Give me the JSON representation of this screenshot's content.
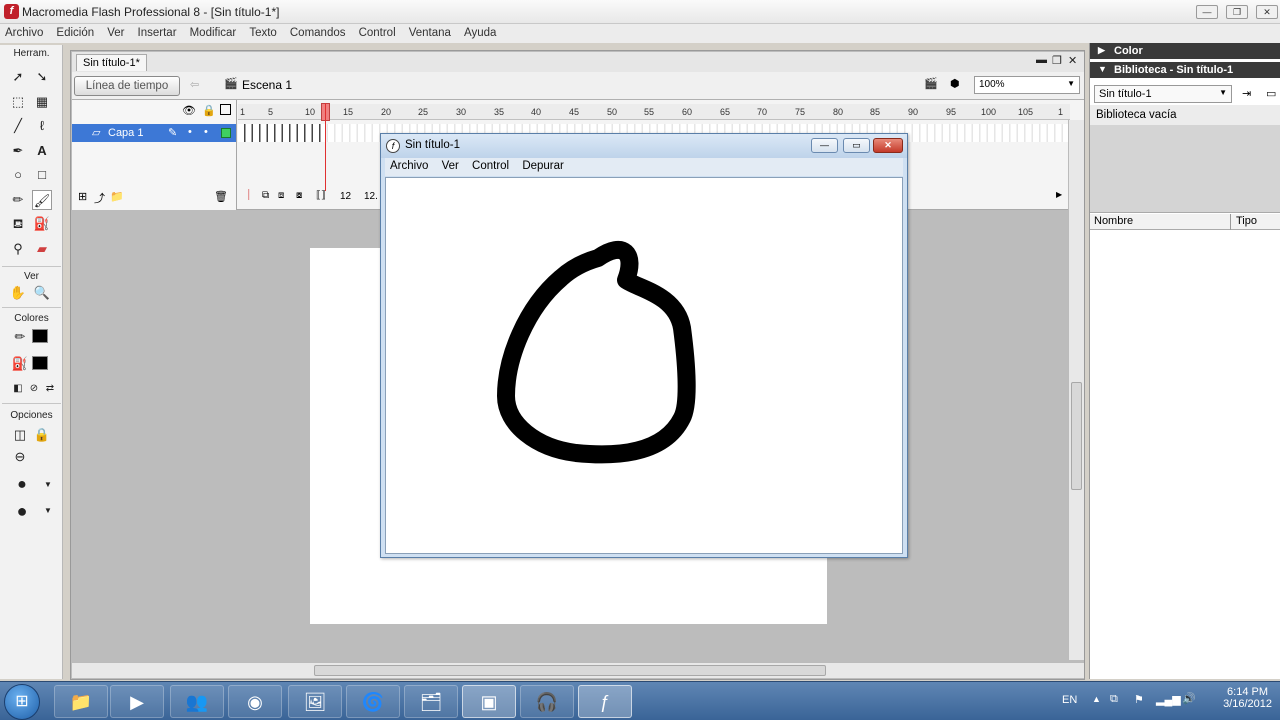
{
  "app": {
    "title": "Macromedia Flash Professional 8 - [Sin título-1*]",
    "icon": "flash-f-icon"
  },
  "menubar": [
    "Archivo",
    "Edición",
    "Ver",
    "Insertar",
    "Modificar",
    "Texto",
    "Comandos",
    "Control",
    "Ventana",
    "Ayuda"
  ],
  "toolbox": {
    "header": "Herram.",
    "ver_label": "Ver",
    "colores_label": "Colores",
    "opciones_label": "Opciones"
  },
  "document": {
    "tab": "Sin título-1*",
    "timeline_button": "Línea de tiempo",
    "scene": "Escena 1",
    "zoom": "100%"
  },
  "timeline": {
    "layer_name": "Capa 1",
    "ruler_labels": [
      "1",
      "5",
      "10",
      "15",
      "20",
      "25",
      "30",
      "35",
      "40",
      "45",
      "50",
      "55",
      "60",
      "65",
      "70",
      "75",
      "80",
      "85",
      "90",
      "95",
      "100",
      "105",
      "1"
    ],
    "frame_rate": "12",
    "fps_partial": "12."
  },
  "right_panel": {
    "color_header": "Color",
    "library_header": "Biblioteca - Sin título-1",
    "library_select": "Sin título-1",
    "library_empty": "Biblioteca vacía",
    "col_name": "Nombre",
    "col_type": "Tipo"
  },
  "player": {
    "title": "Sin título-1",
    "menu": [
      "Archivo",
      "Ver",
      "Control",
      "Depurar"
    ]
  },
  "taskbar": {
    "lang": "EN",
    "time": "6:14 PM",
    "date": "3/16/2012",
    "items": [
      "explorer-icon",
      "media-player-icon",
      "messenger-icon",
      "chrome-icon",
      "app-icon",
      "swirl-icon",
      "folder-icon",
      "blue-app-icon",
      "headphones-icon",
      "flash-icon"
    ]
  },
  "colors": {
    "layer_highlight": "#3d78d6",
    "playhead": "#e03030",
    "taskbar": "#3a6497"
  }
}
